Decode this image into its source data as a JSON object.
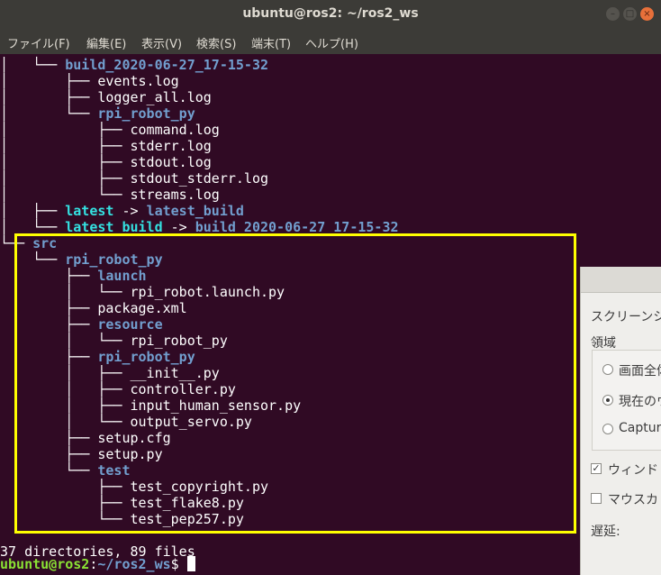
{
  "window": {
    "title": "ubuntu@ros2: ~/ros2_ws",
    "controls": {
      "minimize": "–",
      "maximize": "□",
      "close": "×"
    }
  },
  "menubar": [
    "ファイル(F)",
    "編集(E)",
    "表示(V)",
    "検索(S)",
    "端末(T)",
    "ヘルプ(H)"
  ],
  "terminal": {
    "lines": [
      {
        "prefix": "│   └── ",
        "segments": [
          {
            "text": "build_2020-06-27_17-15-32",
            "type": "dir"
          }
        ]
      },
      {
        "prefix": "│       ├── ",
        "segments": [
          {
            "text": "events.log",
            "type": "file"
          }
        ]
      },
      {
        "prefix": "│       ├── ",
        "segments": [
          {
            "text": "logger_all.log",
            "type": "file"
          }
        ]
      },
      {
        "prefix": "│       └── ",
        "segments": [
          {
            "text": "rpi_robot_py",
            "type": "dir"
          }
        ]
      },
      {
        "prefix": "│           ├── ",
        "segments": [
          {
            "text": "command.log",
            "type": "file"
          }
        ]
      },
      {
        "prefix": "│           ├── ",
        "segments": [
          {
            "text": "stderr.log",
            "type": "file"
          }
        ]
      },
      {
        "prefix": "│           ├── ",
        "segments": [
          {
            "text": "stdout.log",
            "type": "file"
          }
        ]
      },
      {
        "prefix": "│           ├── ",
        "segments": [
          {
            "text": "stdout_stderr.log",
            "type": "file"
          }
        ]
      },
      {
        "prefix": "│           └── ",
        "segments": [
          {
            "text": "streams.log",
            "type": "file"
          }
        ]
      },
      {
        "prefix": "│   ├── ",
        "segments": [
          {
            "text": "latest",
            "type": "link"
          },
          {
            "text": " -> ",
            "type": "file"
          },
          {
            "text": "latest_build",
            "type": "dir"
          }
        ]
      },
      {
        "prefix": "│   └── ",
        "segments": [
          {
            "text": "latest_build",
            "type": "link"
          },
          {
            "text": " -> ",
            "type": "file"
          },
          {
            "text": "build_2020-06-27_17-15-32",
            "type": "dir"
          }
        ]
      },
      {
        "prefix": "└── ",
        "segments": [
          {
            "text": "src",
            "type": "dir"
          }
        ]
      },
      {
        "prefix": "    └── ",
        "segments": [
          {
            "text": "rpi_robot_py",
            "type": "dir"
          }
        ]
      },
      {
        "prefix": "        ├── ",
        "segments": [
          {
            "text": "launch",
            "type": "dir"
          }
        ]
      },
      {
        "prefix": "        │   └── ",
        "segments": [
          {
            "text": "rpi_robot.launch.py",
            "type": "file"
          }
        ]
      },
      {
        "prefix": "        ├── ",
        "segments": [
          {
            "text": "package.xml",
            "type": "file"
          }
        ]
      },
      {
        "prefix": "        ├── ",
        "segments": [
          {
            "text": "resource",
            "type": "dir"
          }
        ]
      },
      {
        "prefix": "        │   └── ",
        "segments": [
          {
            "text": "rpi_robot_py",
            "type": "file"
          }
        ]
      },
      {
        "prefix": "        ├── ",
        "segments": [
          {
            "text": "rpi_robot_py",
            "type": "dir"
          }
        ]
      },
      {
        "prefix": "        │   ├── ",
        "segments": [
          {
            "text": "__init__.py",
            "type": "file"
          }
        ]
      },
      {
        "prefix": "        │   ├── ",
        "segments": [
          {
            "text": "controller.py",
            "type": "file"
          }
        ]
      },
      {
        "prefix": "        │   ├── ",
        "segments": [
          {
            "text": "input_human_sensor.py",
            "type": "file"
          }
        ]
      },
      {
        "prefix": "        │   └── ",
        "segments": [
          {
            "text": "output_servo.py",
            "type": "file"
          }
        ]
      },
      {
        "prefix": "        ├── ",
        "segments": [
          {
            "text": "setup.cfg",
            "type": "file"
          }
        ]
      },
      {
        "prefix": "        ├── ",
        "segments": [
          {
            "text": "setup.py",
            "type": "file"
          }
        ]
      },
      {
        "prefix": "        └── ",
        "segments": [
          {
            "text": "test",
            "type": "dir"
          }
        ]
      },
      {
        "prefix": "            ├── ",
        "segments": [
          {
            "text": "test_copyright.py",
            "type": "file"
          }
        ]
      },
      {
        "prefix": "            ├── ",
        "segments": [
          {
            "text": "test_flake8.py",
            "type": "file"
          }
        ]
      },
      {
        "prefix": "            └── ",
        "segments": [
          {
            "text": "test_pep257.py",
            "type": "file"
          }
        ]
      },
      {
        "prefix": "",
        "segments": [
          {
            "text": "",
            "type": "file"
          }
        ]
      },
      {
        "prefix": "",
        "segments": [
          {
            "text": "37 directories, 89 files",
            "type": "file"
          }
        ]
      }
    ],
    "prompt": {
      "user_host": "ubuntu@ros2",
      "colon": ":",
      "path": "~/ros2_ws",
      "symbol": "$ "
    }
  },
  "highlight": {
    "color": "#ffff00"
  },
  "dialog": {
    "title": "スクリーンシ",
    "area_label": "領域",
    "options": [
      {
        "label": "画面全体",
        "selected": false
      },
      {
        "label": "現在のウ",
        "selected": true
      },
      {
        "label": "Capture",
        "selected": false
      }
    ],
    "checkboxes": [
      {
        "label": "ウィンド",
        "checked": true
      },
      {
        "label": "マウスカ",
        "checked": false
      }
    ],
    "delay_label": "遅延:"
  },
  "colors": {
    "background": "#300a24",
    "directory": "#729fcf",
    "symlink": "#34e2e2",
    "prompt_user": "#8ae234",
    "text": "#ffffff"
  }
}
